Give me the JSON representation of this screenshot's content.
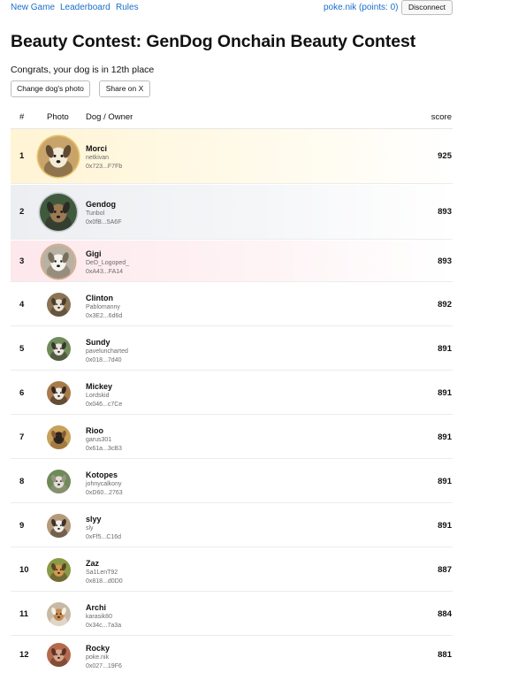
{
  "nav": {
    "new_game": "New Game",
    "leaderboard": "Leaderboard",
    "rules": "Rules",
    "user": "poke.nik (points: 0)",
    "disconnect": "Disconnect"
  },
  "page": {
    "title": "Beauty Contest: GenDog Onchain Beauty Contest",
    "status": "Congrats, your dog is in 12th place",
    "change_photo": "Change dog's photo",
    "share": "Share on X"
  },
  "table": {
    "headers": {
      "rank": "#",
      "photo": "Photo",
      "dog_owner": "Dog / Owner",
      "score": "score"
    },
    "rows": [
      {
        "rank": "1",
        "name": "Morci",
        "owner": "netkivan",
        "address": "0x723...F7Fb",
        "score": "925",
        "photo_tones": [
          "#c9a46a",
          "#f3ead8",
          "#5e4a33"
        ]
      },
      {
        "rank": "2",
        "name": "Gendog",
        "owner": "Tunbol",
        "address": "0x0fB...5A6F",
        "score": "893",
        "photo_tones": [
          "#3f5a3c",
          "#9b7a54",
          "#2c2a25"
        ]
      },
      {
        "rank": "3",
        "name": "Gigi",
        "owner": "DeD_Logoped_",
        "address": "0xA43...FA14",
        "score": "893",
        "photo_tones": [
          "#b9b2a2",
          "#f5f3ee",
          "#7a6f5d"
        ]
      },
      {
        "rank": "4",
        "name": "Clinton",
        "owner": "Pablomanny",
        "address": "0x3E2...6d6d",
        "score": "892",
        "photo_tones": [
          "#8b7355",
          "#e9e1d2",
          "#4a3c2c"
        ]
      },
      {
        "rank": "5",
        "name": "Sundy",
        "owner": "paveluncharted",
        "address": "0x018...7d40",
        "score": "891",
        "photo_tones": [
          "#6f8c5a",
          "#e8e4dc",
          "#3a3530"
        ]
      },
      {
        "rank": "6",
        "name": "Mickey",
        "owner": "Lordskid",
        "address": "0x046...c7Ce",
        "score": "891",
        "photo_tones": [
          "#a97a4a",
          "#f0e9de",
          "#2e2824"
        ]
      },
      {
        "rank": "7",
        "name": "Rioo",
        "owner": "garus301",
        "address": "0x61a...3cB3",
        "score": "891",
        "photo_tones": [
          "#c6a15a",
          "#2b241f",
          "#8a5a2e"
        ]
      },
      {
        "rank": "8",
        "name": "Kotopes",
        "owner": "johnycalkony",
        "address": "0xD60...2763",
        "score": "891",
        "photo_tones": [
          "#6e8a58",
          "#e2ddd3",
          "#9a9388"
        ]
      },
      {
        "rank": "9",
        "name": "slyy",
        "owner": "sly",
        "address": "0xFf5...C16d",
        "score": "891",
        "photo_tones": [
          "#b49a7b",
          "#f2ede6",
          "#3b332b"
        ]
      },
      {
        "rank": "10",
        "name": "Zaz",
        "owner": "Sa1LenT92",
        "address": "0x818...d0D0",
        "score": "887",
        "photo_tones": [
          "#8a9a46",
          "#d19a4e",
          "#5c4427"
        ]
      },
      {
        "rank": "11",
        "name": "Archi",
        "owner": "karasik80",
        "address": "0x34c...7a3a",
        "score": "884",
        "photo_tones": [
          "#c7b9a4",
          "#c48a4e",
          "#f3efe8"
        ]
      },
      {
        "rank": "12",
        "name": "Rocky",
        "owner": "poke.nik",
        "address": "0x027...19F6",
        "score": "881",
        "photo_tones": [
          "#b56a4e",
          "#d9a58a",
          "#5a3426"
        ]
      }
    ]
  },
  "colors": {
    "link": "#1a6fc8",
    "gold_highlight": "#fff4d4",
    "silver_highlight": "#eceef1",
    "bronze_highlight": "#fde8ec"
  }
}
